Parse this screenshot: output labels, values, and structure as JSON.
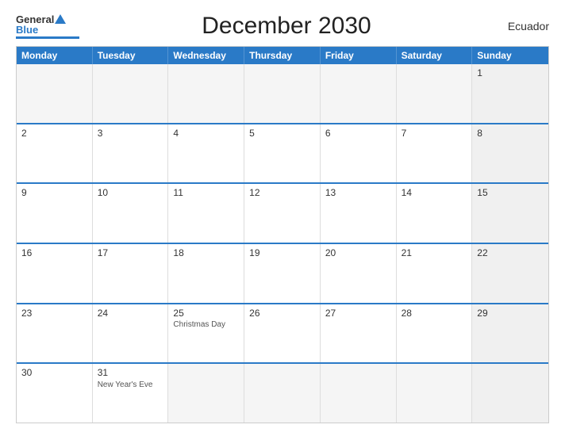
{
  "header": {
    "title": "December 2030",
    "country": "Ecuador"
  },
  "logo": {
    "line1": "General",
    "line2": "Blue"
  },
  "dayHeaders": [
    "Monday",
    "Tuesday",
    "Wednesday",
    "Thursday",
    "Friday",
    "Saturday",
    "Sunday"
  ],
  "weeks": [
    [
      {
        "day": "",
        "empty": true
      },
      {
        "day": "",
        "empty": true
      },
      {
        "day": "",
        "empty": true
      },
      {
        "day": "",
        "empty": true
      },
      {
        "day": "",
        "empty": true
      },
      {
        "day": "",
        "empty": true
      },
      {
        "day": "1",
        "sunday": true
      }
    ],
    [
      {
        "day": "2"
      },
      {
        "day": "3"
      },
      {
        "day": "4"
      },
      {
        "day": "5"
      },
      {
        "day": "6"
      },
      {
        "day": "7"
      },
      {
        "day": "8",
        "sunday": true
      }
    ],
    [
      {
        "day": "9"
      },
      {
        "day": "10"
      },
      {
        "day": "11"
      },
      {
        "day": "12"
      },
      {
        "day": "13"
      },
      {
        "day": "14"
      },
      {
        "day": "15",
        "sunday": true
      }
    ],
    [
      {
        "day": "16"
      },
      {
        "day": "17"
      },
      {
        "day": "18"
      },
      {
        "day": "19"
      },
      {
        "day": "20"
      },
      {
        "day": "21"
      },
      {
        "day": "22",
        "sunday": true
      }
    ],
    [
      {
        "day": "23"
      },
      {
        "day": "24"
      },
      {
        "day": "25",
        "event": "Christmas Day"
      },
      {
        "day": "26"
      },
      {
        "day": "27"
      },
      {
        "day": "28"
      },
      {
        "day": "29",
        "sunday": true
      }
    ],
    [
      {
        "day": "30"
      },
      {
        "day": "31",
        "event": "New Year's Eve"
      },
      {
        "day": "",
        "empty": true
      },
      {
        "day": "",
        "empty": true
      },
      {
        "day": "",
        "empty": true
      },
      {
        "day": "",
        "empty": true
      },
      {
        "day": "",
        "empty": true,
        "sunday": true
      }
    ]
  ]
}
